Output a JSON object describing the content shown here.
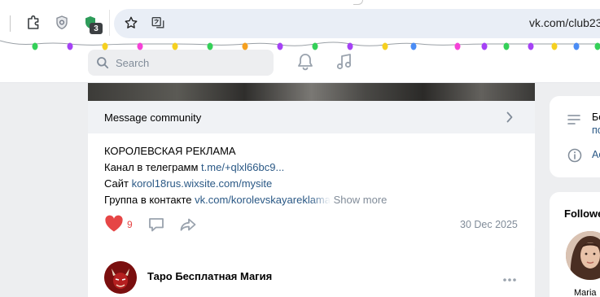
{
  "browser": {
    "url": "vk.com/club23",
    "extension_badge": "3"
  },
  "header": {
    "search_placeholder": "Search"
  },
  "post": {
    "message_label": "Message community",
    "line1": "КОРОЛЕВСКАЯ РЕКЛАМА",
    "line2_prefix": "Канал в телеграмм ",
    "line2_link": "t.me/+qlxl66bc9...",
    "line3_prefix": "Сайт ",
    "line3_link": "korol18rus.wixsite.com/mysite",
    "line4_prefix": "Группа в контакте ",
    "line4_link": "vk.com/korolevskayareklama",
    "show_more": "Show more",
    "likes": "9",
    "date": "30 Dec 2025"
  },
  "post2": {
    "title": "Таро Бесплатная Магия"
  },
  "sidebar": {
    "item1_line1": "Бе",
    "item1_line2": "по",
    "item2": "Ас",
    "followers_title": "Followe",
    "follower_name": "Maria"
  },
  "colors": {
    "link": "#2a5885",
    "like": "#e64646",
    "muted": "#818c99"
  }
}
